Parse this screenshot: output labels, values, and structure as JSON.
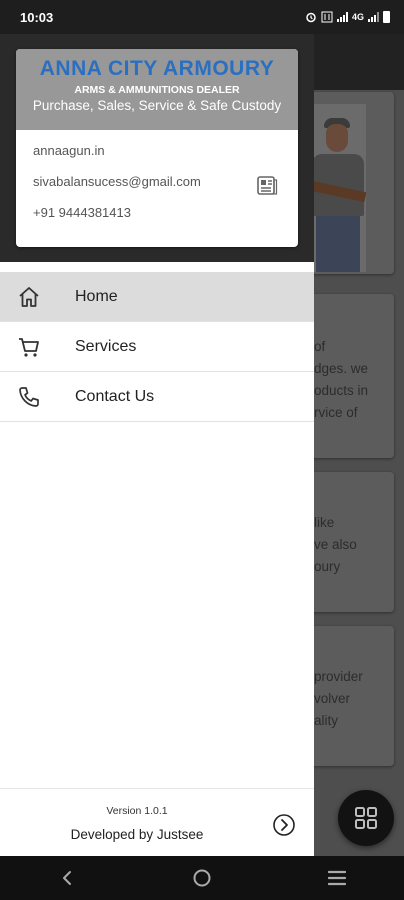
{
  "status_bar": {
    "time": "10:03",
    "network": "4G"
  },
  "drawer": {
    "header": {
      "title": "ANNA CITY ARMOURY",
      "subtitle": "ARMS & AMMUNITIONS DEALER",
      "tagline": "Purchase, Sales, Service & Safe Custody",
      "website": "annaagun.in",
      "email": "sivabalansucess@gmail.com",
      "phone": "+91 9444381413"
    },
    "menu": [
      {
        "label": "Home",
        "icon": "home-icon",
        "active": true
      },
      {
        "label": "Services",
        "icon": "cart-icon",
        "active": false
      },
      {
        "label": "Contact Us",
        "icon": "phone-icon",
        "active": false
      }
    ],
    "footer": {
      "version": "Version 1.0.1",
      "developed_by": "Developed by Justsee"
    }
  },
  "background": {
    "card1_lines": [
      "of",
      "dges. we",
      "oducts in",
      "rvice of"
    ],
    "card2_lines": [
      "like",
      "ve also",
      "oury"
    ],
    "card3_lines": [
      "provider",
      "volver",
      "ality"
    ]
  },
  "colors": {
    "brand_title": "#2a6fc1",
    "header_bg": "#989898",
    "active_item": "#dcdcdc"
  }
}
